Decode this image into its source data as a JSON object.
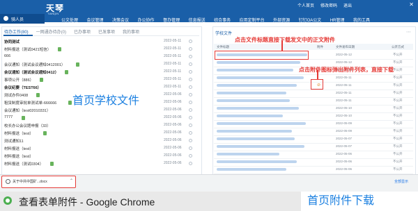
{
  "app": {
    "logo": "天琴",
    "logo_sub": "TIANQIN"
  },
  "top_links": [
    "个人首页",
    "修改密码",
    "退出"
  ],
  "user": {
    "name": "骑人员"
  },
  "nav": [
    "公文处理",
    "会议管理",
    "决策会议",
    "办公协作",
    "督办管理",
    "信息报送",
    "综合事务",
    "应用定制平台",
    "外部资源",
    "钉钉OA公文",
    "HR管理",
    "我的工具"
  ],
  "left_panel": {
    "tabs": [
      {
        "label": "待办工作(80)",
        "active": true
      },
      {
        "label": "一网通办待办(0)",
        "active": false
      },
      {
        "label": "已办事项",
        "active": false
      },
      {
        "label": "已发事项",
        "active": false
      },
      {
        "label": "我的事项",
        "active": false
      }
    ],
    "rows": [
      {
        "title": "协同测试",
        "date": "2022-05-11",
        "bold": true,
        "file": false
      },
      {
        "title": "材料报送（测试0421短信）",
        "date": "2022-05-11",
        "bold": false,
        "file": true
      },
      {
        "title": "666",
        "date": "2022-05-11",
        "bold": false,
        "file": false
      },
      {
        "title": "会议通知（测试会议通知0412001）",
        "date": "2022-05-11",
        "bold": false,
        "file": true
      },
      {
        "title": "会议通知（测试会议通知0412）",
        "date": "2022-05-11",
        "bold": true,
        "file": true
      },
      {
        "title": "事项公开（886）",
        "date": "2022-05-11",
        "bold": false,
        "file": true
      },
      {
        "title": "会议纪要（TEST66）",
        "date": "2022-05-11",
        "bold": true,
        "file": false
      },
      {
        "title": "测试办件0408",
        "date": "2022-05-06",
        "bold": false,
        "file": true
      },
      {
        "title": "租赁制度审批单测试单-666666",
        "date": "2022-05-06",
        "bold": false,
        "file": true
      },
      {
        "title": "会议通知（test02010331）",
        "date": "2022-05-06",
        "bold": false,
        "file": false
      },
      {
        "title": "7777",
        "date": "2022-05-06",
        "bold": false,
        "file": true
      },
      {
        "title": "校长办公会议题申报（33）",
        "date": "2022-05-06",
        "bold": false,
        "file": false
      },
      {
        "title": "材料报送（test）",
        "date": "2022-05-06",
        "bold": false,
        "file": true
      },
      {
        "title": "测试通知11",
        "date": "2022-05-06",
        "bold": false,
        "file": false
      },
      {
        "title": "材料报送（test）",
        "date": "2022-05-06",
        "bold": false,
        "file": false
      },
      {
        "title": "材料报送（test）",
        "date": "2022-05-06",
        "bold": false,
        "file": false
      },
      {
        "title": "材料报送（测试0304）",
        "date": "2022-05-06",
        "bold": false,
        "file": true
      }
    ]
  },
  "right_panel": {
    "title": "学校文件",
    "more": "⋯",
    "headers": {
      "title": "文件标题",
      "attach": "附件",
      "date": "文件发布日期",
      "unit": "公开方式"
    },
    "rows": [
      {
        "date": "2022-05-12",
        "unit": "不公开",
        "clip": false,
        "w": 130
      },
      {
        "date": "2022-05-12",
        "unit": "不公开",
        "clip": false,
        "w": 120
      },
      {
        "date": "2022-05-12",
        "unit": "不公开",
        "clip": false,
        "w": 110
      },
      {
        "date": "2022-05-11",
        "unit": "不公开",
        "clip": false,
        "w": 125
      },
      {
        "date": "2022-05-11",
        "unit": "不公开",
        "clip": true,
        "w": 115
      },
      {
        "date": "2022-05-11",
        "unit": "不公开",
        "clip": false,
        "w": 100
      },
      {
        "date": "2022-05-11",
        "unit": "不公开",
        "clip": false,
        "w": 105
      },
      {
        "date": "2022-05-10",
        "unit": "不公开",
        "clip": false,
        "w": 118
      },
      {
        "date": "2022-05-10",
        "unit": "不公开",
        "clip": false,
        "w": 95
      },
      {
        "date": "2022-05-09",
        "unit": "不公开",
        "clip": false,
        "w": 128
      },
      {
        "date": "2022-05-09",
        "unit": "不公开",
        "clip": false,
        "w": 108
      },
      {
        "date": "2022-05-07",
        "unit": "不公开",
        "clip": false,
        "w": 112
      },
      {
        "date": "2022-05-07",
        "unit": "不公开",
        "clip": false,
        "w": 126
      },
      {
        "date": "2022-05-06",
        "unit": "不公开",
        "clip": false,
        "w": 90
      },
      {
        "date": "2022-05-06",
        "unit": "不公开",
        "clip": false,
        "w": 115
      },
      {
        "date": "2022-05-06",
        "unit": "不公开",
        "clip": false,
        "w": 100
      }
    ]
  },
  "annotations": {
    "top": "点击文件标题直接下载发文中的正文附件",
    "middle": "点击附件图标弹出附件列表，直接下载",
    "caption_left": "首页学校文件",
    "caption_right": "首页附件下载"
  },
  "download_bar": {
    "filename": "关于中共中国矿...docx",
    "chevron": "⌃",
    "show_all": "全部显示"
  },
  "taskbar": {
    "title": "查看表单附件 - Google Chrome"
  },
  "colors": {
    "brand": "#1a5fa8",
    "annotation": "#e53935",
    "caption": "#1a7fe0"
  }
}
